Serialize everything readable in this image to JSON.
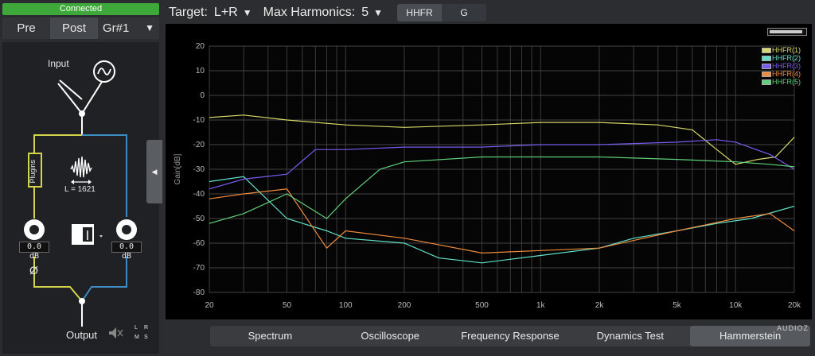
{
  "left": {
    "status": "Connected",
    "mode": {
      "pre": "Pre",
      "post": "Post",
      "group": "Gr#1",
      "group_arrow": "▼"
    },
    "routing": {
      "input_label": "Input",
      "plugins_label": "Plugins",
      "latency_label": "L = 1621",
      "left_gain": "0.0 dB",
      "right_gain": "0.0 dB",
      "phase_symbol": "Ø",
      "output_label": "Output",
      "channel_l": "L",
      "channel_r": "R",
      "channel_m": "M",
      "channel_s": "S"
    },
    "collapse_arrow": "◀"
  },
  "toolbar": {
    "target_label": "Target:",
    "target_value": "L+R",
    "harmonics_label": "Max Harmonics:",
    "harmonics_value": "5",
    "arrow": "▼",
    "view_hhfr": "HHFR",
    "view_g": "G"
  },
  "plot": {
    "progress": 0.9,
    "legend": [
      {
        "name": "HHFR(1)",
        "color": "#d8d86a"
      },
      {
        "name": "HHFR(2)",
        "color": "#5fe0c8"
      },
      {
        "name": "HHFR(3)",
        "color": "#7a5cf0"
      },
      {
        "name": "HHFR(4)",
        "color": "#f08a3c"
      },
      {
        "name": "HHFR(5)",
        "color": "#5fd07a"
      }
    ]
  },
  "chart_data": {
    "type": "line",
    "title": "",
    "xlabel": "",
    "ylabel": "Gain[dB]",
    "x_scale": "log",
    "xlim": [
      20,
      20000
    ],
    "ylim": [
      -80,
      20
    ],
    "x_ticks": [
      20,
      50,
      100,
      200,
      500,
      1000,
      2000,
      5000,
      10000,
      20000
    ],
    "x_tick_labels": [
      "20",
      "50",
      "100",
      "200",
      "500",
      "1k",
      "2k",
      "5k",
      "10k",
      "20k"
    ],
    "y_ticks": [
      20,
      10,
      0,
      -10,
      -20,
      -30,
      -40,
      -50,
      -60,
      -70,
      -80
    ],
    "grid": true,
    "legend_position": "top-right",
    "series": [
      {
        "name": "HHFR(1)",
        "color": "#d8d86a",
        "x": [
          20,
          30,
          50,
          100,
          200,
          500,
          1000,
          2000,
          4000,
          6000,
          8000,
          10000,
          13000,
          16000,
          20000
        ],
        "y": [
          -9,
          -8,
          -10,
          -12,
          -13,
          -12,
          -11,
          -11,
          -12,
          -14,
          -22,
          -28,
          -26,
          -25,
          -17
        ]
      },
      {
        "name": "HHFR(2)",
        "color": "#5fe0c8",
        "x": [
          20,
          30,
          50,
          80,
          100,
          200,
          300,
          500,
          1000,
          2000,
          3000,
          5000,
          8000,
          12000,
          20000
        ],
        "y": [
          -35,
          -33,
          -50,
          -55,
          -58,
          -60,
          -66,
          -68,
          -65,
          -62,
          -58,
          -55,
          -52,
          -50,
          -45
        ]
      },
      {
        "name": "HHFR(3)",
        "color": "#7a5cf0",
        "x": [
          20,
          30,
          50,
          70,
          100,
          200,
          500,
          1000,
          2000,
          5000,
          8000,
          10000,
          15000,
          20000
        ],
        "y": [
          -38,
          -34,
          -32,
          -22,
          -22,
          -21,
          -21,
          -20,
          -20,
          -19,
          -18,
          -19,
          -24,
          -30
        ]
      },
      {
        "name": "HHFR(4)",
        "color": "#f08a3c",
        "x": [
          20,
          30,
          50,
          80,
          100,
          200,
          500,
          1000,
          2000,
          5000,
          10000,
          15000,
          20000
        ],
        "y": [
          -42,
          -40,
          -38,
          -62,
          -55,
          -58,
          -64,
          -63,
          -62,
          -55,
          -50,
          -48,
          -55
        ]
      },
      {
        "name": "HHFR(5)",
        "color": "#5fd07a",
        "x": [
          20,
          30,
          50,
          80,
          100,
          150,
          200,
          500,
          1000,
          2000,
          5000,
          10000,
          15000,
          20000
        ],
        "y": [
          -52,
          -48,
          -40,
          -50,
          -42,
          -30,
          -27,
          -25,
          -25,
          -25,
          -26,
          -27,
          -28,
          -29
        ]
      }
    ]
  },
  "bottom_tabs": [
    {
      "label": "Spectrum",
      "active": false
    },
    {
      "label": "Oscilloscope",
      "active": false
    },
    {
      "label": "Frequency Response",
      "active": false
    },
    {
      "label": "Dynamics Test",
      "active": false
    },
    {
      "label": "Hammerstein",
      "active": true
    }
  ],
  "watermark": "AUDIOZ"
}
